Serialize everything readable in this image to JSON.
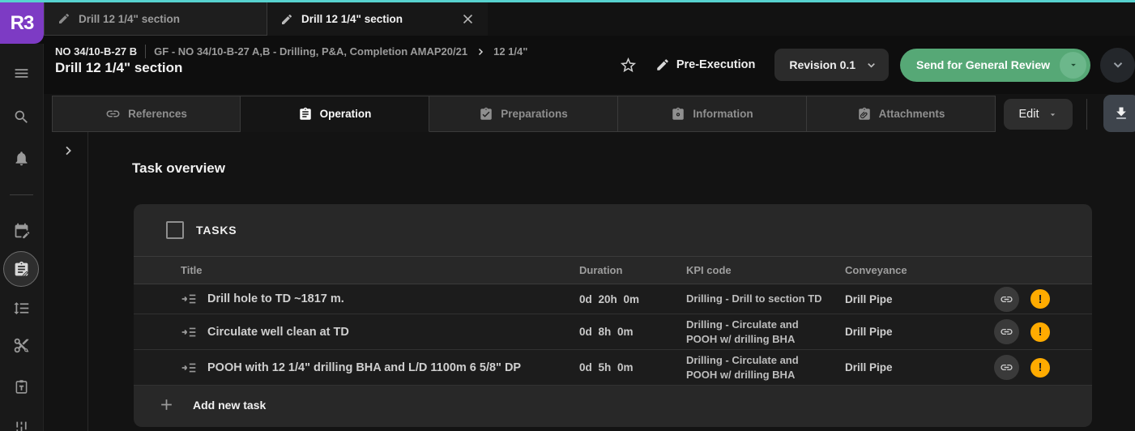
{
  "window": {
    "tabs": [
      {
        "label": "Drill 12 1/4\" section",
        "active": false
      },
      {
        "label": "Drill 12 1/4\" section",
        "active": true
      }
    ],
    "logo_text": "R3"
  },
  "header": {
    "well": "NO 34/10-B-27 B",
    "breadcrumb": "GF - NO 34/10-B-27 A,B - Drilling, P&A, Completion AMAP20/21",
    "breadcrumb_leaf": "12 1/4\"",
    "title": "Drill 12 1/4\" section",
    "phase_label": "Pre-Execution",
    "revision_label": "Revision 0.1",
    "send_button_label": "Send for General Review"
  },
  "nav": {
    "tabs": [
      {
        "label": "References",
        "icon": "link-icon",
        "active": false
      },
      {
        "label": "Operation",
        "icon": "clipboard-list-icon",
        "active": true
      },
      {
        "label": "Preparations",
        "icon": "clipboard-check-icon",
        "active": false
      },
      {
        "label": "Information",
        "icon": "clipboard-gear-icon",
        "active": false
      },
      {
        "label": "Attachments",
        "icon": "clipboard-paperclip-icon",
        "active": false
      }
    ],
    "edit_label": "Edit"
  },
  "sidebar": {
    "icons": [
      "menu-icon",
      "search-icon",
      "notifications-bell-icon",
      "edit-calendar-icon",
      "operation-clipboard-edit-icon",
      "line-spacing-icon",
      "cut-settings-icon",
      "text-clipboard-icon",
      "tune-icon"
    ],
    "active_icon": "operation-clipboard-edit-icon"
  },
  "main": {
    "heading": "Task overview",
    "table": {
      "group_label": "TASKS",
      "columns": [
        "Title",
        "Duration",
        "KPI code",
        "Conveyance"
      ],
      "rows": [
        {
          "title": "Drill hole to TD ~1817 m.",
          "duration": "0d 20h 0m",
          "kpi": "Drilling - Drill to section TD",
          "conveyance": "Drill Pipe",
          "warning": "!"
        },
        {
          "title": "Circulate well clean at TD",
          "duration": "0d 8h 0m",
          "kpi": "Drilling - Circulate and POOH w/ drilling BHA",
          "conveyance": "Drill Pipe",
          "warning": "!"
        },
        {
          "title": "POOH with 12 1/4\" drilling BHA and L/D 1100m 6 5/8\" DP",
          "duration": "0d 5h 0m",
          "kpi": "Drilling - Circulate and POOH w/ drilling BHA",
          "conveyance": "Drill Pipe",
          "warning": "!"
        }
      ],
      "add_label": "Add new task"
    }
  },
  "colors": {
    "accent_teal": "#57d2cf",
    "brand_purple": "#7d3bc4",
    "action_green": "#56a876",
    "warning_amber": "#ffab00"
  }
}
